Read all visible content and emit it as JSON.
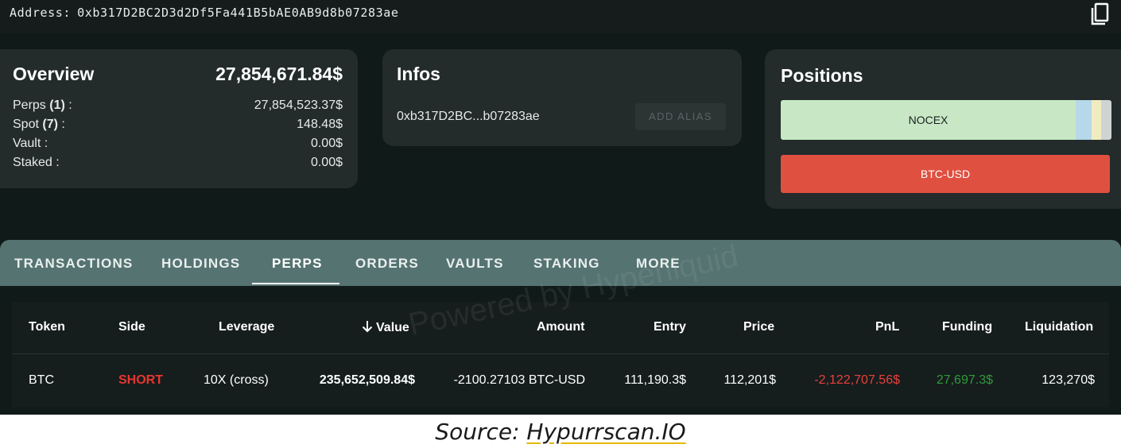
{
  "address_bar": {
    "label": "Address",
    "address": "0xb317D2BC2D3d2Df5Fa441B5bAE0AB9d8b07283ae",
    "copy_icon": "copy-icon"
  },
  "overview": {
    "title": "Overview",
    "total": "27,854,671.84$",
    "rows": [
      {
        "label": "Perps",
        "count": "(1)",
        "suffix": " :",
        "value": "27,854,523.37$"
      },
      {
        "label": "Spot",
        "count": "(7)",
        "suffix": " :",
        "value": "148.48$"
      },
      {
        "label": "Vault :",
        "count": "",
        "suffix": "",
        "value": "0.00$"
      },
      {
        "label": "Staked :",
        "count": "",
        "suffix": "",
        "value": "0.00$"
      }
    ]
  },
  "infos": {
    "title": "Infos",
    "short_address": "0xb317D2BC...b07283ae",
    "add_alias_label": "ADD ALIAS"
  },
  "positions": {
    "title": "Positions",
    "bar1_label": "NOCEX",
    "bar2_label": "BTC-USD"
  },
  "tabs": {
    "items": [
      "TRANSACTIONS",
      "HOLDINGS",
      "PERPS",
      "ORDERS",
      "VAULTS",
      "STAKING",
      "MORE"
    ],
    "active": "PERPS"
  },
  "table": {
    "headers": {
      "token": "Token",
      "side": "Side",
      "leverage": "Leverage",
      "value": "Value",
      "amount": "Amount",
      "entry": "Entry",
      "price": "Price",
      "pnl": "PnL",
      "funding": "Funding",
      "liquidation": "Liquidation"
    },
    "sort_icon": "arrow-down-icon",
    "rows": [
      {
        "token": "BTC",
        "side": "SHORT",
        "leverage": "10X (cross)",
        "value": "235,652,509.84$",
        "amount": "-2100.27103 BTC-USD",
        "entry": "111,190.3$",
        "price": "112,201$",
        "pnl": "-2,122,707.56$",
        "funding": "27,697.3$",
        "liquidation": "123,270$"
      }
    ]
  },
  "watermark": "Powered by Hyperliquid",
  "caption": {
    "prefix": "Source: ",
    "link": "Hypurrscan.IO"
  },
  "colors": {
    "short": "#e8352f",
    "pnl_negative": "#e8403a",
    "funding_positive": "#2f9a3b",
    "nocex_bar": "#c8e8c5",
    "btc_bar": "#e05040",
    "tabs_bg": "#557371"
  }
}
